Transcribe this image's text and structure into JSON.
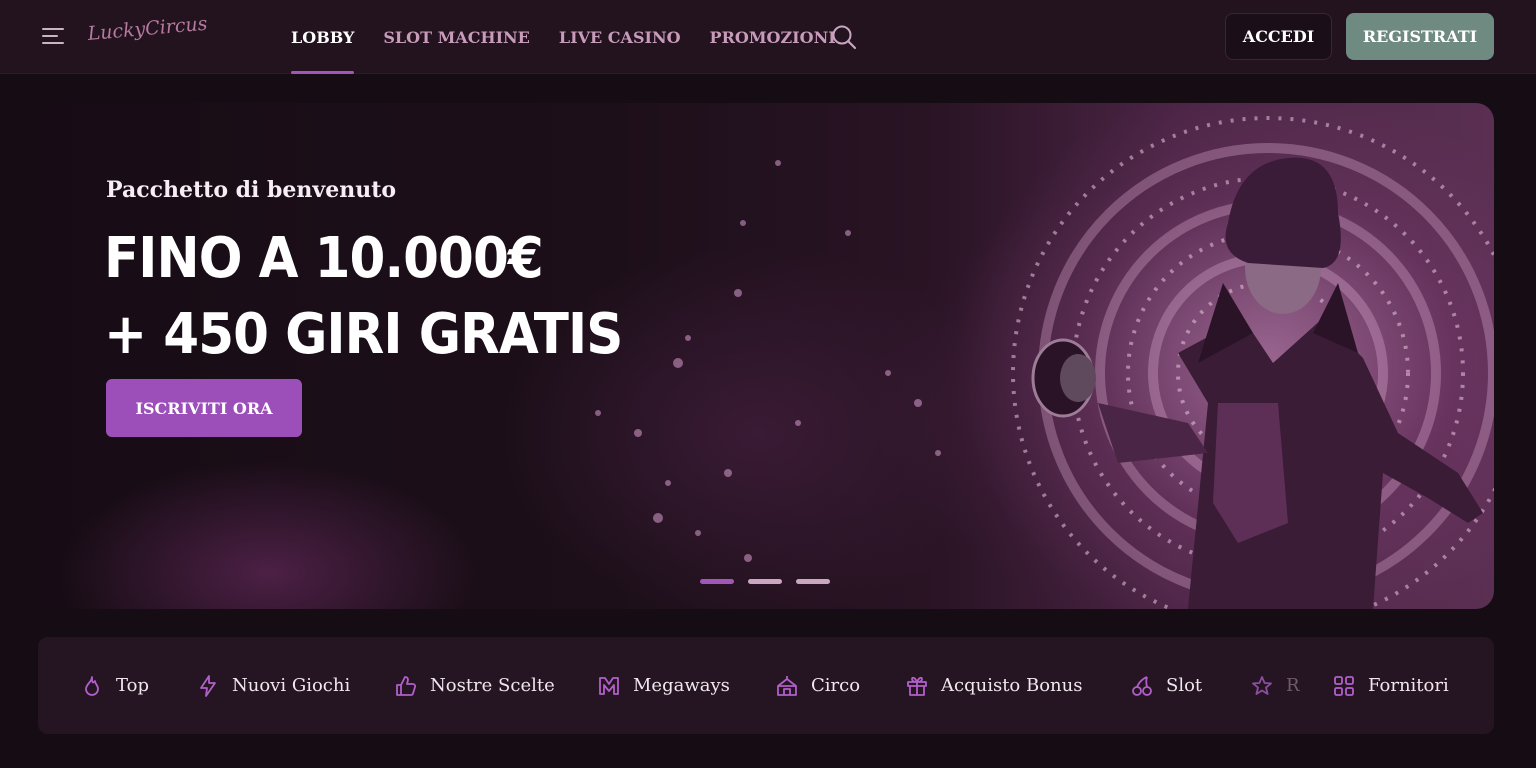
{
  "header": {
    "logo_text": "LuckyCircus",
    "nav": [
      {
        "label": "LOBBY",
        "active": true
      },
      {
        "label": "SLOT MACHINE",
        "active": false
      },
      {
        "label": "LIVE CASINO",
        "active": false
      },
      {
        "label": "PROMOZIONI",
        "active": false
      }
    ],
    "login_label": "ACCEDI",
    "register_label": "REGISTRATI"
  },
  "hero": {
    "subtitle": "Pacchetto di benvenuto",
    "title_line1": "FINO A 10.000€",
    "title_line2": "+ 450 GIRI GRATIS",
    "cta_label": "ISCRIVITI ORA",
    "slides_total": 3,
    "active_slide": 1
  },
  "categories": [
    {
      "label": "Top",
      "icon": "flame-icon"
    },
    {
      "label": "Nuovi Giochi",
      "icon": "lightning-icon"
    },
    {
      "label": "Nostre Scelte",
      "icon": "thumbs-up-icon"
    },
    {
      "label": "Megaways",
      "icon": "megaways-icon"
    },
    {
      "label": "Circo",
      "icon": "circus-tent-icon"
    },
    {
      "label": "Acquisto Bonus",
      "icon": "gift-icon"
    },
    {
      "label": "Slot",
      "icon": "cherries-icon"
    },
    {
      "label": "R",
      "icon": "star-icon"
    },
    {
      "label": "Fornitori",
      "icon": "grid-icon"
    }
  ],
  "colors": {
    "background": "#160d14",
    "header_bg": "#22131f",
    "accent_purple": "#a157b9",
    "register_button": "#6f8a81",
    "nav_inactive": "#c79bb9"
  }
}
